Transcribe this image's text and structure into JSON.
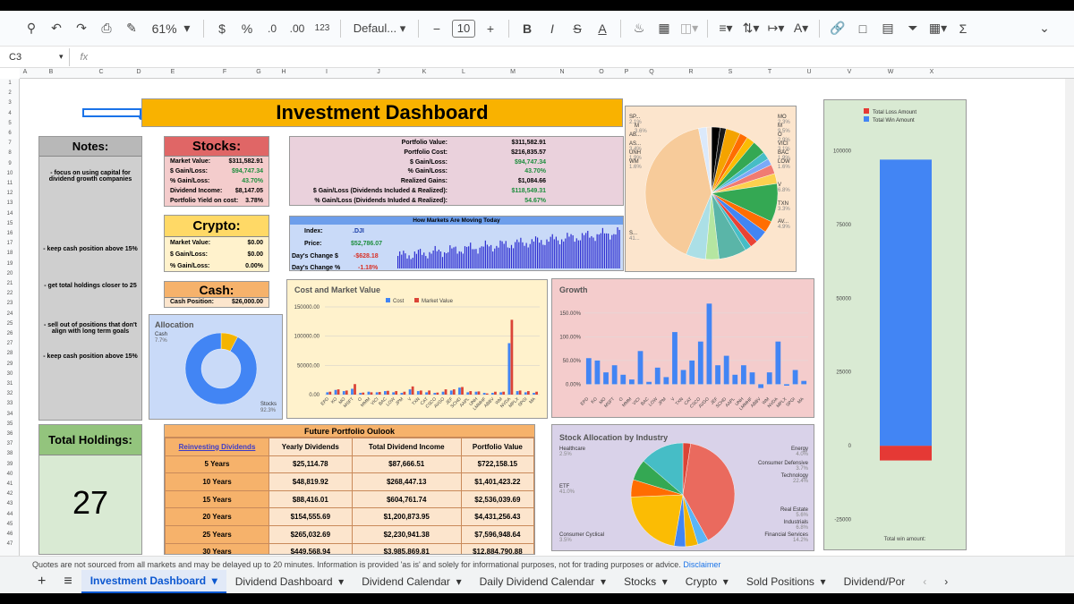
{
  "toolbar": {
    "zoom": "61%",
    "currency": "$",
    "percent": "%",
    "dec_less": ".0",
    "dec_more": ".00",
    "format123": "123",
    "font": "Defaul...",
    "font_size": "10",
    "bold": "B",
    "italic": "I",
    "strike": "S",
    "text_color": "A"
  },
  "formula_bar": {
    "cell_ref": "C3",
    "fx": "fx",
    "value": ""
  },
  "columns": [
    "A",
    "B",
    "C",
    "D",
    "E",
    "F",
    "G",
    "H",
    "I",
    "J",
    "K",
    "L",
    "M",
    "N",
    "O",
    "P",
    "Q",
    "R",
    "S",
    "T",
    "U",
    "V",
    "W",
    "X"
  ],
  "rows": [
    "1",
    "2",
    "3",
    "4",
    "5",
    "6",
    "7",
    "8",
    "9",
    "10",
    "11",
    "12",
    "13",
    "14",
    "15",
    "16",
    "17",
    "18",
    "19",
    "20",
    "21",
    "22",
    "23",
    "24",
    "25",
    "26",
    "27",
    "28",
    "29",
    "30",
    "31",
    "32",
    "33",
    "34",
    "35",
    "36",
    "37",
    "38",
    "39",
    "40",
    "41",
    "42",
    "43",
    "44",
    "45",
    "46",
    "47"
  ],
  "dashboard": {
    "title": "Investment Dashboard"
  },
  "notes": {
    "title": "Notes:",
    "items": [
      "- focus on using capital for dividend growth companies",
      "- keep cash position above 15%",
      "- get total holdings closer to 25",
      "- sell out of positions that don't align with long term goals",
      "- keep cash position above 15%"
    ]
  },
  "stocks": {
    "title": "Stocks:",
    "rows": [
      {
        "label": "Market Value:",
        "value": "$311,582.91"
      },
      {
        "label": "$ Gain/Loss:",
        "value": "$94,747.34"
      },
      {
        "label": "% Gain/Loss:",
        "value": "43.70%"
      },
      {
        "label": "Dividend Income:",
        "value": "$8,147.05"
      },
      {
        "label": "Portfolio Yield on cost:",
        "value": "3.78%"
      }
    ]
  },
  "crypto": {
    "title": "Crypto:",
    "rows": [
      {
        "label": "Market Value:",
        "value": "$0.00"
      },
      {
        "label": "$ Gain/Loss:",
        "value": "$0.00"
      },
      {
        "label": "% Gain/Loss:",
        "value": "0.00%"
      }
    ]
  },
  "cash": {
    "title": "Cash:",
    "label": "Cash Position:",
    "value": "$26,000.00"
  },
  "portfolio": {
    "rows": [
      {
        "label": "Portfolio Value:",
        "value": "$311,582.91"
      },
      {
        "label": "Portfolio Cost:",
        "value": "$216,835.57"
      },
      {
        "label": "$ Gain/Loss:",
        "value": "$94,747.34"
      },
      {
        "label": "% Gain/Loss:",
        "value": "43.70%"
      },
      {
        "label": "Realized Gains:",
        "value": "$1,084.66"
      },
      {
        "label": "$ Gain/Loss (Dividends Included & Realized):",
        "value": "$118,549.31"
      },
      {
        "label": "% Gain/Loss (Dividends Inluded & Realized):",
        "value": "54.67%"
      }
    ]
  },
  "markets": {
    "title": "How Markets Are Moving Today",
    "index_label": "Index:",
    "index_value": ".DJI",
    "price_label": "Price:",
    "price_value": "$52,786.07",
    "chg_label": "Day's Change $",
    "chg_value": "-$628.18",
    "pct_label": "Day's Change %",
    "pct_value": "-1.18%"
  },
  "holdings": {
    "title": "Total Holdings:",
    "value": "27"
  },
  "future": {
    "title": "Future Portfolio Oulook",
    "headers": [
      "Reinvesting Dividends",
      "Yearly Dividends",
      "Total Dividend Income",
      "Portfolio Value"
    ],
    "rows": [
      [
        "5 Years",
        "$25,114.78",
        "$87,666.51",
        "$722,158.15"
      ],
      [
        "10 Years",
        "$48,819.92",
        "$268,447.13",
        "$1,401,423.22"
      ],
      [
        "15 Years",
        "$88,416.01",
        "$604,761.74",
        "$2,536,039.69"
      ],
      [
        "20 Years",
        "$154,555.69",
        "$1,200,873.95",
        "$4,431,256.43"
      ],
      [
        "25 Years",
        "$265,032.69",
        "$2,230,941.38",
        "$7,596,948.64"
      ],
      [
        "30 Years",
        "$449,568.94",
        "$3,985,869.81",
        "$12,884,790.88"
      ]
    ]
  },
  "footer": {
    "text": "Quotes are not sourced from all markets and may be delayed up to 20 minutes. Information is provided 'as is' and solely for informational purposes, not for trading purposes or advice.",
    "link": "Disclaimer"
  },
  "tabs": [
    "Investment Dashboard",
    "Dividend Dashboard",
    "Dividend Calendar",
    "Daily Dividend Calendar",
    "Stocks",
    "Crypto",
    "Sold Positions",
    "Dividend/Por"
  ],
  "chart_data": [
    {
      "type": "pie",
      "id": "holdings_pie",
      "labels": [
        "SP...",
        "M",
        "AB...",
        "AS...",
        "UNH",
        "WM",
        "MO",
        "M",
        "O",
        "VICI",
        "BAC",
        "LOW",
        "V",
        "TXN",
        "AV...",
        "S..."
      ],
      "label_values": [
        "2.1%",
        "3.6%",
        "",
        "3.4%",
        "1.9%",
        "1.6%",
        "2.3%",
        "9.5%",
        "2.9%",
        "3.1%",
        "1.9%",
        "1.6%",
        "6.8%",
        "3.3%",
        "4.9%",
        "41..."
      ],
      "values": [
        2.1,
        1.5,
        3.6,
        2,
        2,
        3.4,
        1.9,
        1.6,
        2.3,
        2.5,
        9.5,
        2.9,
        3.1,
        1.9,
        1.6,
        6.8,
        3.3,
        4.9,
        41,
        2,
        1.2
      ],
      "colors": [
        "#000000",
        "#1a1a1a",
        "#f4a300",
        "#ff6d01",
        "#fbbc04",
        "#34a853",
        "#46bdc6",
        "#7baaf7",
        "#f07b72",
        "#fcd04f",
        "#34a853",
        "#ff6d01",
        "#4285f4",
        "#ea4335",
        "#46bdc6",
        "#5ab5a8",
        "#b5e6a1",
        "#abdfe6",
        "#f7cb9a",
        "#dbe9fb",
        "#f6e3d1"
      ]
    },
    {
      "type": "bar",
      "id": "win_loss",
      "series": [
        {
          "name": "Total Loss Amount",
          "values": [
            -5000
          ],
          "color": "#e53935"
        },
        {
          "name": "Total Win Amount",
          "values": [
            97000
          ],
          "color": "#4285f4"
        }
      ],
      "yticks": [
        100000,
        75000,
        50000,
        25000,
        0,
        -25000
      ],
      "ylim": [
        -30000,
        105000
      ],
      "xlabel": "Total win amount:"
    },
    {
      "type": "pie",
      "id": "allocation",
      "title": "Allocation",
      "labels": [
        "Cash",
        "Stocks"
      ],
      "label_values": [
        "7.7%",
        "92.3%"
      ],
      "values": [
        7.7,
        92.3
      ],
      "colors": [
        "#f4b400",
        "#4285f4"
      ]
    },
    {
      "type": "bar",
      "id": "cost_market",
      "title": "Cost and Market Value",
      "series": [
        {
          "name": "Cost",
          "color": "#4285f4"
        },
        {
          "name": "Market Value",
          "color": "#db4437"
        }
      ],
      "yticks": [
        "150000.00",
        "100000.00",
        "50000.00",
        "0.00"
      ],
      "ylim": [
        0,
        150000
      ],
      "categories": [
        "EPD",
        "KO",
        "MO",
        "MSFT",
        "O",
        "MMM",
        "VICI",
        "BAC",
        "LOW",
        "JPM",
        "V",
        "TXN",
        "CAT",
        "CSCO",
        "AVGO",
        "JEF",
        "SCHD",
        "AAPL",
        "UNH",
        "LMMHF",
        "ABBV",
        "WM",
        "NVDA",
        "MPLX",
        "SPGI",
        "MA"
      ],
      "cost": [
        4000,
        8000,
        6000,
        10000,
        3000,
        5000,
        4000,
        6000,
        4000,
        3000,
        9000,
        6000,
        4000,
        3000,
        5000,
        7000,
        12000,
        4000,
        5000,
        3000,
        3000,
        4000,
        88000,
        6000,
        4000,
        3000
      ],
      "market": [
        5000,
        9000,
        7000,
        18000,
        3500,
        4000,
        4500,
        6500,
        6000,
        5000,
        14000,
        7000,
        7000,
        3500,
        9000,
        9000,
        13000,
        6000,
        5500,
        2000,
        5000,
        5000,
        128000,
        7000,
        6000,
        5000
      ]
    },
    {
      "type": "bar",
      "id": "growth",
      "title": "Growth",
      "yticks": [
        "150.00%",
        "100.00%",
        "50.00%",
        "0.00%"
      ],
      "ylim": [
        -20,
        180
      ],
      "categories": [
        "EPD",
        "KO",
        "MO",
        "MSFT",
        "O",
        "MMM",
        "VICI",
        "BAC",
        "LOW",
        "JPM",
        "V",
        "TXN",
        "CAT",
        "CSCO",
        "AVGO",
        "JEF",
        "SCHD",
        "AAPL",
        "UNH",
        "LMMHF",
        "ABBV",
        "WM",
        "NVDA",
        "MPLX",
        "SPGI",
        "MA"
      ],
      "values": [
        55,
        50,
        25,
        40,
        20,
        10,
        70,
        5,
        35,
        15,
        110,
        30,
        50,
        90,
        170,
        40,
        60,
        20,
        40,
        25,
        -8,
        25,
        90,
        -3,
        30,
        7
      ],
      "color": "#4285f4"
    },
    {
      "type": "pie",
      "id": "industry",
      "title": "Stock Allocation by Industry",
      "labels": [
        "Healthcare",
        "ETF",
        "Consumer Cyclical",
        "Energy",
        "Consumer Defensive",
        "Technology",
        "Real Estate",
        "Industrials",
        "Financial Services"
      ],
      "label_values": [
        "2.5%",
        "41.0%",
        "3.5%",
        "4.0%",
        "3.7%",
        "22.4%",
        "5.6%",
        "6.8%",
        "14.2%"
      ],
      "values": [
        2.5,
        41,
        3.5,
        4,
        3.7,
        22.4,
        5.6,
        6.8,
        14.2
      ],
      "colors": [
        "#db4437",
        "#ea6a5e",
        "#5ab5f6",
        "#f4b400",
        "#4285f4",
        "#fbbc04",
        "#ff6d01",
        "#34a853",
        "#46bdc6"
      ]
    }
  ]
}
